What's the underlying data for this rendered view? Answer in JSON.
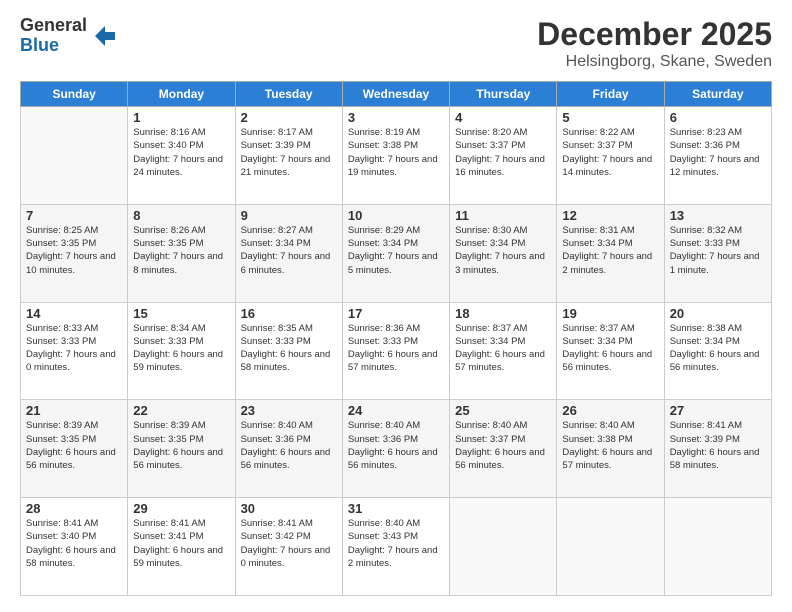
{
  "logo": {
    "general": "General",
    "blue": "Blue",
    "arrow_color": "#1a6aaa"
  },
  "title": "December 2025",
  "subtitle": "Helsingborg, Skane, Sweden",
  "weekdays": [
    "Sunday",
    "Monday",
    "Tuesday",
    "Wednesday",
    "Thursday",
    "Friday",
    "Saturday"
  ],
  "weeks": [
    [
      {
        "day": "",
        "empty": true
      },
      {
        "day": "1",
        "sunrise": "8:16 AM",
        "sunset": "3:40 PM",
        "daylight": "7 hours and 24 minutes."
      },
      {
        "day": "2",
        "sunrise": "8:17 AM",
        "sunset": "3:39 PM",
        "daylight": "7 hours and 21 minutes."
      },
      {
        "day": "3",
        "sunrise": "8:19 AM",
        "sunset": "3:38 PM",
        "daylight": "7 hours and 19 minutes."
      },
      {
        "day": "4",
        "sunrise": "8:20 AM",
        "sunset": "3:37 PM",
        "daylight": "7 hours and 16 minutes."
      },
      {
        "day": "5",
        "sunrise": "8:22 AM",
        "sunset": "3:37 PM",
        "daylight": "7 hours and 14 minutes."
      },
      {
        "day": "6",
        "sunrise": "8:23 AM",
        "sunset": "3:36 PM",
        "daylight": "7 hours and 12 minutes."
      }
    ],
    [
      {
        "day": "7",
        "sunrise": "8:25 AM",
        "sunset": "3:35 PM",
        "daylight": "7 hours and 10 minutes."
      },
      {
        "day": "8",
        "sunrise": "8:26 AM",
        "sunset": "3:35 PM",
        "daylight": "7 hours and 8 minutes."
      },
      {
        "day": "9",
        "sunrise": "8:27 AM",
        "sunset": "3:34 PM",
        "daylight": "7 hours and 6 minutes."
      },
      {
        "day": "10",
        "sunrise": "8:29 AM",
        "sunset": "3:34 PM",
        "daylight": "7 hours and 5 minutes."
      },
      {
        "day": "11",
        "sunrise": "8:30 AM",
        "sunset": "3:34 PM",
        "daylight": "7 hours and 3 minutes."
      },
      {
        "day": "12",
        "sunrise": "8:31 AM",
        "sunset": "3:34 PM",
        "daylight": "7 hours and 2 minutes."
      },
      {
        "day": "13",
        "sunrise": "8:32 AM",
        "sunset": "3:33 PM",
        "daylight": "7 hours and 1 minute."
      }
    ],
    [
      {
        "day": "14",
        "sunrise": "8:33 AM",
        "sunset": "3:33 PM",
        "daylight": "7 hours and 0 minutes."
      },
      {
        "day": "15",
        "sunrise": "8:34 AM",
        "sunset": "3:33 PM",
        "daylight": "6 hours and 59 minutes."
      },
      {
        "day": "16",
        "sunrise": "8:35 AM",
        "sunset": "3:33 PM",
        "daylight": "6 hours and 58 minutes."
      },
      {
        "day": "17",
        "sunrise": "8:36 AM",
        "sunset": "3:33 PM",
        "daylight": "6 hours and 57 minutes."
      },
      {
        "day": "18",
        "sunrise": "8:37 AM",
        "sunset": "3:34 PM",
        "daylight": "6 hours and 57 minutes."
      },
      {
        "day": "19",
        "sunrise": "8:37 AM",
        "sunset": "3:34 PM",
        "daylight": "6 hours and 56 minutes."
      },
      {
        "day": "20",
        "sunrise": "8:38 AM",
        "sunset": "3:34 PM",
        "daylight": "6 hours and 56 minutes."
      }
    ],
    [
      {
        "day": "21",
        "sunrise": "8:39 AM",
        "sunset": "3:35 PM",
        "daylight": "6 hours and 56 minutes."
      },
      {
        "day": "22",
        "sunrise": "8:39 AM",
        "sunset": "3:35 PM",
        "daylight": "6 hours and 56 minutes."
      },
      {
        "day": "23",
        "sunrise": "8:40 AM",
        "sunset": "3:36 PM",
        "daylight": "6 hours and 56 minutes."
      },
      {
        "day": "24",
        "sunrise": "8:40 AM",
        "sunset": "3:36 PM",
        "daylight": "6 hours and 56 minutes."
      },
      {
        "day": "25",
        "sunrise": "8:40 AM",
        "sunset": "3:37 PM",
        "daylight": "6 hours and 56 minutes."
      },
      {
        "day": "26",
        "sunrise": "8:40 AM",
        "sunset": "3:38 PM",
        "daylight": "6 hours and 57 minutes."
      },
      {
        "day": "27",
        "sunrise": "8:41 AM",
        "sunset": "3:39 PM",
        "daylight": "6 hours and 58 minutes."
      }
    ],
    [
      {
        "day": "28",
        "sunrise": "8:41 AM",
        "sunset": "3:40 PM",
        "daylight": "6 hours and 58 minutes."
      },
      {
        "day": "29",
        "sunrise": "8:41 AM",
        "sunset": "3:41 PM",
        "daylight": "6 hours and 59 minutes."
      },
      {
        "day": "30",
        "sunrise": "8:41 AM",
        "sunset": "3:42 PM",
        "daylight": "7 hours and 0 minutes."
      },
      {
        "day": "31",
        "sunrise": "8:40 AM",
        "sunset": "3:43 PM",
        "daylight": "7 hours and 2 minutes."
      },
      {
        "day": "",
        "empty": true
      },
      {
        "day": "",
        "empty": true
      },
      {
        "day": "",
        "empty": true
      }
    ]
  ],
  "sunrise_label": "Sunrise:",
  "sunset_label": "Sunset:",
  "daylight_label": "Daylight:"
}
